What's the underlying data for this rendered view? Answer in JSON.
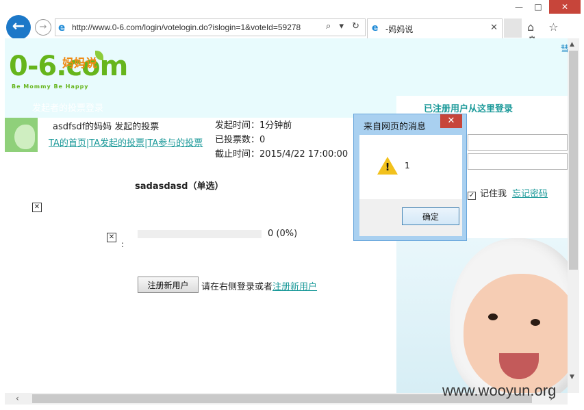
{
  "window": {
    "minimize": "—",
    "maximize": "□",
    "close": "✕"
  },
  "nav": {
    "back": "←",
    "forward": "→",
    "url": "http://www.0-6.com/login/votelogin.do?islogin=1&voteId=59278",
    "address_icons": "⌕ ▾ ↻",
    "tab_title": "-妈妈说",
    "tab_close": "✕",
    "toolbar_icons": "⌂ ☆ ⚙"
  },
  "header": {
    "logo_text": "0-6",
    "logo_dot_com": ".com",
    "logo_cn": "妈妈说",
    "logo_tagline": "Be Mommy Be Happy",
    "right_fragment": "彗"
  },
  "strip": {
    "text": "发起者的投票登录"
  },
  "vote": {
    "title": "asdfsdf的妈妈 发起的投票",
    "links": [
      "TA的首页",
      "TA发起的投票",
      "TA参与的投票"
    ],
    "separator": "|",
    "start_time": "发起时间：1分钟前",
    "vote_count": "已投票数：0",
    "end_time": "截止时间：2015/4/22 17:00:00",
    "question": "sadasdasd（单选）",
    "broken_image": "✕",
    "colon": ":",
    "result": "0 (0%)",
    "result_fraction": 0,
    "register_button": "注册新用户",
    "register_hint": "请在右侧登录或者",
    "register_link": "注册新用户"
  },
  "login": {
    "title": "已注册用户从这里登录",
    "remember_check": "✓",
    "remember": "记住我",
    "forgot": "忘记密码"
  },
  "scroll": {
    "up": "▲",
    "down": "▼",
    "left": "‹",
    "right": "›"
  },
  "watermark": "www.wooyun.org",
  "dialog": {
    "title": "来自网页的消息",
    "close": "✕",
    "warn_mark": "!",
    "message": "1",
    "ok": "确定"
  }
}
